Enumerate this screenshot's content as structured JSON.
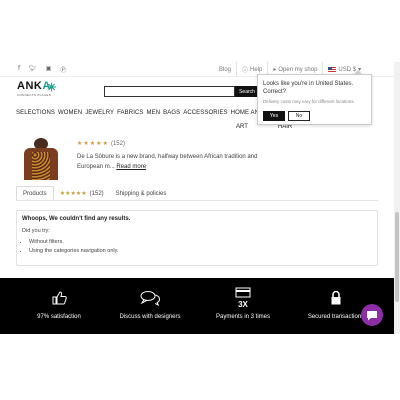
{
  "topbar": {
    "social": [
      "facebook-icon",
      "twitter-icon",
      "instagram-icon",
      "pinterest-icon"
    ],
    "blog": "Blog",
    "help": "Help",
    "open_shop": "Open my shop",
    "currency": "USD $"
  },
  "logo": {
    "brand_a": "ANK",
    "brand_b": "A",
    "tagline": "CONNECTS PLACES"
  },
  "search": {
    "placeholder": "",
    "button": "Search"
  },
  "nav": {
    "items": [
      "SELECTIONS",
      "WOMEN",
      "JEWELRY",
      "FABRICS",
      "MEN",
      "BAGS",
      "ACCESSORIES",
      "HOME AND"
    ],
    "second_row": [
      "ART",
      "HAIR"
    ]
  },
  "popup": {
    "question": "Looks like you're in United States. Correct?",
    "note": "Delivery costs may vary for different locations.",
    "yes": "Yes",
    "no": "No"
  },
  "product": {
    "rating": 5,
    "review_count": "(152)",
    "description": "De La Sôbure is a new brand, halfway between African tradition and European m...",
    "read_more": "Read more"
  },
  "tabs": {
    "products": "Products",
    "reviews_count": "(152)",
    "shipping": "Shipping & policies"
  },
  "empty": {
    "title": "Whoops, We couldn't find any results.",
    "intro": "Did you try:",
    "items": [
      "Without filters.",
      "Using the categories navigation only."
    ]
  },
  "features": [
    {
      "icon": "thumbs-up-icon",
      "label": "97% satisfaction"
    },
    {
      "icon": "chat-bubbles-icon",
      "label": "Discuss with designers"
    },
    {
      "icon": "card-3x-icon",
      "label": "Payments in 3 times",
      "badge": "3X"
    },
    {
      "icon": "lock-icon",
      "label": "Secured transactions"
    }
  ],
  "colors": {
    "accent": "#1a9c8a",
    "star": "#c89c3c",
    "chat": "#8d2ea8",
    "footer": "#000000"
  }
}
